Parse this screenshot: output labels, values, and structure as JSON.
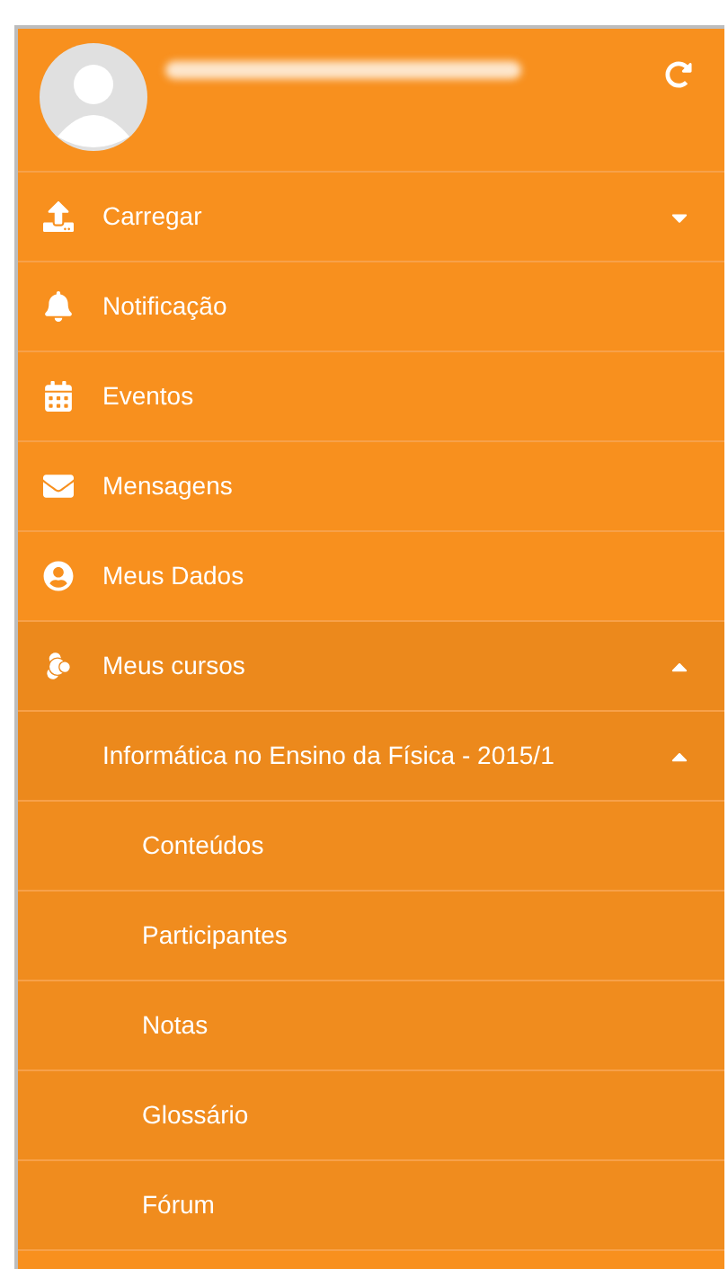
{
  "menu": [
    {
      "label": "Carregar",
      "expanded": false
    },
    {
      "label": "Notificação"
    },
    {
      "label": "Eventos"
    },
    {
      "label": "Mensagens"
    },
    {
      "label": "Meus Dados"
    },
    {
      "label": "Meus cursos",
      "expanded": true,
      "children": [
        {
          "label": "Informática no Ensino da Física - 2015/1",
          "expanded": true,
          "children": [
            {
              "label": "Conteúdos"
            },
            {
              "label": "Participantes"
            },
            {
              "label": "Notas"
            },
            {
              "label": "Glossário"
            },
            {
              "label": "Fórum"
            }
          ]
        }
      ]
    }
  ]
}
